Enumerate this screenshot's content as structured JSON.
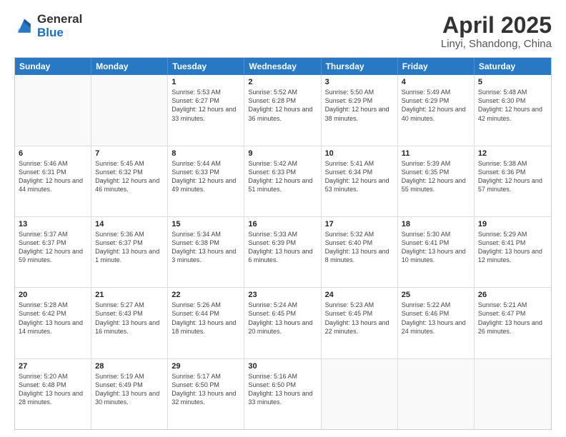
{
  "header": {
    "logo_general": "General",
    "logo_blue": "Blue",
    "title": "April 2025",
    "location": "Linyi, Shandong, China"
  },
  "days_of_week": [
    "Sunday",
    "Monday",
    "Tuesday",
    "Wednesday",
    "Thursday",
    "Friday",
    "Saturday"
  ],
  "weeks": [
    [
      {
        "day": "",
        "empty": true
      },
      {
        "day": "",
        "empty": true
      },
      {
        "day": "1",
        "sunrise": "Sunrise: 5:53 AM",
        "sunset": "Sunset: 6:27 PM",
        "daylight": "Daylight: 12 hours and 33 minutes."
      },
      {
        "day": "2",
        "sunrise": "Sunrise: 5:52 AM",
        "sunset": "Sunset: 6:28 PM",
        "daylight": "Daylight: 12 hours and 36 minutes."
      },
      {
        "day": "3",
        "sunrise": "Sunrise: 5:50 AM",
        "sunset": "Sunset: 6:29 PM",
        "daylight": "Daylight: 12 hours and 38 minutes."
      },
      {
        "day": "4",
        "sunrise": "Sunrise: 5:49 AM",
        "sunset": "Sunset: 6:29 PM",
        "daylight": "Daylight: 12 hours and 40 minutes."
      },
      {
        "day": "5",
        "sunrise": "Sunrise: 5:48 AM",
        "sunset": "Sunset: 6:30 PM",
        "daylight": "Daylight: 12 hours and 42 minutes."
      }
    ],
    [
      {
        "day": "6",
        "sunrise": "Sunrise: 5:46 AM",
        "sunset": "Sunset: 6:31 PM",
        "daylight": "Daylight: 12 hours and 44 minutes."
      },
      {
        "day": "7",
        "sunrise": "Sunrise: 5:45 AM",
        "sunset": "Sunset: 6:32 PM",
        "daylight": "Daylight: 12 hours and 46 minutes."
      },
      {
        "day": "8",
        "sunrise": "Sunrise: 5:44 AM",
        "sunset": "Sunset: 6:33 PM",
        "daylight": "Daylight: 12 hours and 49 minutes."
      },
      {
        "day": "9",
        "sunrise": "Sunrise: 5:42 AM",
        "sunset": "Sunset: 6:33 PM",
        "daylight": "Daylight: 12 hours and 51 minutes."
      },
      {
        "day": "10",
        "sunrise": "Sunrise: 5:41 AM",
        "sunset": "Sunset: 6:34 PM",
        "daylight": "Daylight: 12 hours and 53 minutes."
      },
      {
        "day": "11",
        "sunrise": "Sunrise: 5:39 AM",
        "sunset": "Sunset: 6:35 PM",
        "daylight": "Daylight: 12 hours and 55 minutes."
      },
      {
        "day": "12",
        "sunrise": "Sunrise: 5:38 AM",
        "sunset": "Sunset: 6:36 PM",
        "daylight": "Daylight: 12 hours and 57 minutes."
      }
    ],
    [
      {
        "day": "13",
        "sunrise": "Sunrise: 5:37 AM",
        "sunset": "Sunset: 6:37 PM",
        "daylight": "Daylight: 12 hours and 59 minutes."
      },
      {
        "day": "14",
        "sunrise": "Sunrise: 5:36 AM",
        "sunset": "Sunset: 6:37 PM",
        "daylight": "Daylight: 13 hours and 1 minute."
      },
      {
        "day": "15",
        "sunrise": "Sunrise: 5:34 AM",
        "sunset": "Sunset: 6:38 PM",
        "daylight": "Daylight: 13 hours and 3 minutes."
      },
      {
        "day": "16",
        "sunrise": "Sunrise: 5:33 AM",
        "sunset": "Sunset: 6:39 PM",
        "daylight": "Daylight: 13 hours and 6 minutes."
      },
      {
        "day": "17",
        "sunrise": "Sunrise: 5:32 AM",
        "sunset": "Sunset: 6:40 PM",
        "daylight": "Daylight: 13 hours and 8 minutes."
      },
      {
        "day": "18",
        "sunrise": "Sunrise: 5:30 AM",
        "sunset": "Sunset: 6:41 PM",
        "daylight": "Daylight: 13 hours and 10 minutes."
      },
      {
        "day": "19",
        "sunrise": "Sunrise: 5:29 AM",
        "sunset": "Sunset: 6:41 PM",
        "daylight": "Daylight: 13 hours and 12 minutes."
      }
    ],
    [
      {
        "day": "20",
        "sunrise": "Sunrise: 5:28 AM",
        "sunset": "Sunset: 6:42 PM",
        "daylight": "Daylight: 13 hours and 14 minutes."
      },
      {
        "day": "21",
        "sunrise": "Sunrise: 5:27 AM",
        "sunset": "Sunset: 6:43 PM",
        "daylight": "Daylight: 13 hours and 16 minutes."
      },
      {
        "day": "22",
        "sunrise": "Sunrise: 5:26 AM",
        "sunset": "Sunset: 6:44 PM",
        "daylight": "Daylight: 13 hours and 18 minutes."
      },
      {
        "day": "23",
        "sunrise": "Sunrise: 5:24 AM",
        "sunset": "Sunset: 6:45 PM",
        "daylight": "Daylight: 13 hours and 20 minutes."
      },
      {
        "day": "24",
        "sunrise": "Sunrise: 5:23 AM",
        "sunset": "Sunset: 6:45 PM",
        "daylight": "Daylight: 13 hours and 22 minutes."
      },
      {
        "day": "25",
        "sunrise": "Sunrise: 5:22 AM",
        "sunset": "Sunset: 6:46 PM",
        "daylight": "Daylight: 13 hours and 24 minutes."
      },
      {
        "day": "26",
        "sunrise": "Sunrise: 5:21 AM",
        "sunset": "Sunset: 6:47 PM",
        "daylight": "Daylight: 13 hours and 26 minutes."
      }
    ],
    [
      {
        "day": "27",
        "sunrise": "Sunrise: 5:20 AM",
        "sunset": "Sunset: 6:48 PM",
        "daylight": "Daylight: 13 hours and 28 minutes."
      },
      {
        "day": "28",
        "sunrise": "Sunrise: 5:19 AM",
        "sunset": "Sunset: 6:49 PM",
        "daylight": "Daylight: 13 hours and 30 minutes."
      },
      {
        "day": "29",
        "sunrise": "Sunrise: 5:17 AM",
        "sunset": "Sunset: 6:50 PM",
        "daylight": "Daylight: 13 hours and 32 minutes."
      },
      {
        "day": "30",
        "sunrise": "Sunrise: 5:16 AM",
        "sunset": "Sunset: 6:50 PM",
        "daylight": "Daylight: 13 hours and 33 minutes."
      },
      {
        "day": "",
        "empty": true
      },
      {
        "day": "",
        "empty": true
      },
      {
        "day": "",
        "empty": true
      }
    ]
  ]
}
